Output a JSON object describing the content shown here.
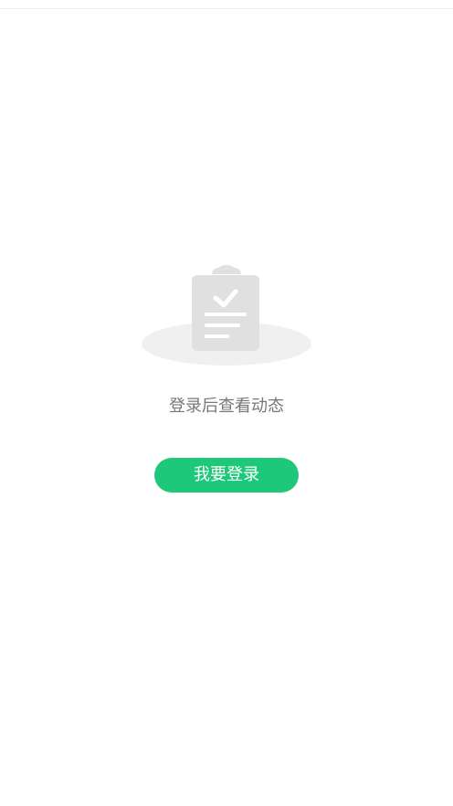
{
  "empty_state": {
    "icon": "clipboard-check-icon",
    "message": "登录后查看动态"
  },
  "login_button": {
    "label": "我要登录"
  },
  "colors": {
    "accent": "#1ec87a",
    "icon_gray": "#e0e0e0",
    "shadow_gray": "#f0f0f0",
    "text_gray": "#777777"
  }
}
